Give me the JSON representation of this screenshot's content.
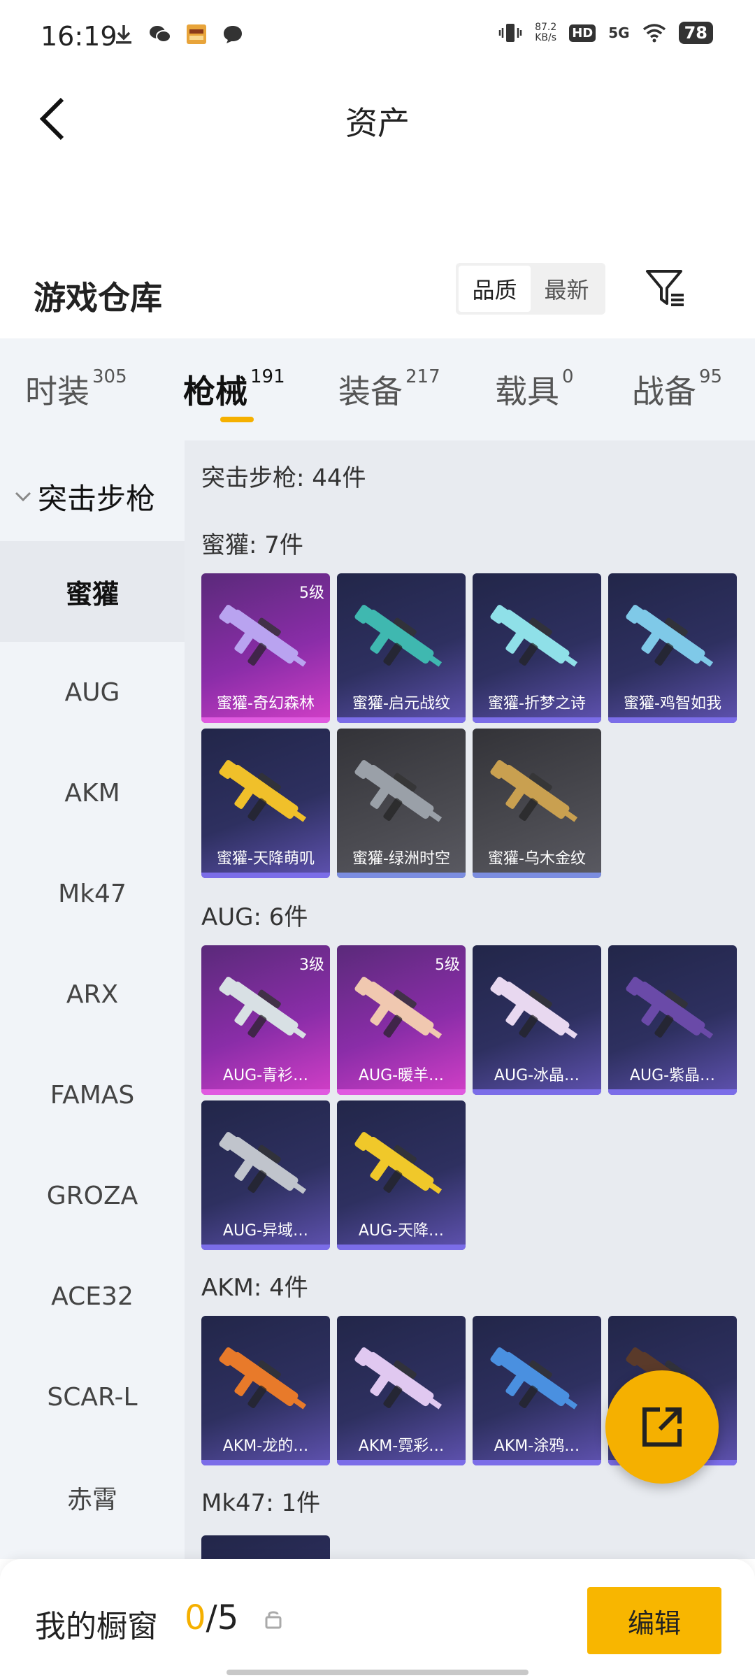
{
  "status_bar": {
    "time": "16:19",
    "speed_value": "87.2",
    "speed_unit": "KB/s",
    "hd": "HD",
    "network": "5G",
    "battery": "78"
  },
  "header": {
    "title": "资产"
  },
  "warehouse": {
    "title": "游戏仓库",
    "sort_options": [
      "品质",
      "最新"
    ],
    "active_sort": "品质"
  },
  "tabs": [
    {
      "label": "时装",
      "count": "305"
    },
    {
      "label": "枪械",
      "count": "191"
    },
    {
      "label": "装备",
      "count": "217"
    },
    {
      "label": "载具",
      "count": "0"
    },
    {
      "label": "战备",
      "count": "95"
    }
  ],
  "sidebar": {
    "category": "突击步枪",
    "items": [
      "蜜獾",
      "AUG",
      "AKM",
      "Mk47",
      "ARX",
      "FAMAS",
      "GROZA",
      "ACE32",
      "SCAR-L",
      "赤霄"
    ],
    "active_item": "蜜獾"
  },
  "content": {
    "category_summary": "突击步枪: 44件",
    "sections": [
      {
        "title": "蜜獾: 7件",
        "items": [
          {
            "name": "蜜獾-奇幻森林",
            "level": "5级",
            "rarity": "purple",
            "gun_color": "#b9a3f0"
          },
          {
            "name": "蜜獾-启元战纹",
            "level": "",
            "rarity": "blue",
            "gun_color": "#3fb8b0"
          },
          {
            "name": "蜜獾-折梦之诗",
            "level": "",
            "rarity": "blue",
            "gun_color": "#8fe0e8"
          },
          {
            "name": "蜜獾-鸡智如我",
            "level": "",
            "rarity": "blue",
            "gun_color": "#7fc9e8"
          },
          {
            "name": "蜜獾-天降萌叽",
            "level": "",
            "rarity": "blue",
            "gun_color": "#f0c02a"
          },
          {
            "name": "蜜獾-绿洲时空",
            "level": "",
            "rarity": "gray",
            "gun_color": "#9aa0a8"
          },
          {
            "name": "蜜獾-乌木金纹",
            "level": "",
            "rarity": "gray",
            "gun_color": "#c9a050"
          }
        ]
      },
      {
        "title": "AUG: 6件",
        "items": [
          {
            "name": "AUG-青衫…",
            "level": "3级",
            "rarity": "purple",
            "gun_color": "#d8e0e4"
          },
          {
            "name": "AUG-暖羊…",
            "level": "5级",
            "rarity": "purple",
            "gun_color": "#f0c8b0"
          },
          {
            "name": "AUG-冰晶…",
            "level": "",
            "rarity": "blue",
            "gun_color": "#e8d8f0"
          },
          {
            "name": "AUG-紫晶…",
            "level": "",
            "rarity": "blue",
            "gun_color": "#6a4aa8"
          },
          {
            "name": "AUG-异域…",
            "level": "",
            "rarity": "blue",
            "gun_color": "#c0c4cc"
          },
          {
            "name": "AUG-天降…",
            "level": "",
            "rarity": "blue",
            "gun_color": "#f0c82a"
          }
        ]
      },
      {
        "title": "AKM: 4件",
        "items": [
          {
            "name": "AKM-龙的…",
            "level": "",
            "rarity": "blue",
            "gun_color": "#e87a2a"
          },
          {
            "name": "AKM-霓彩…",
            "level": "",
            "rarity": "blue",
            "gun_color": "#e0c8f0"
          },
          {
            "name": "AKM-涂鸦…",
            "level": "",
            "rarity": "blue",
            "gun_color": "#4a90e0"
          },
          {
            "name": "",
            "level": "",
            "rarity": "blue",
            "gun_color": "#5a3a2a"
          }
        ]
      },
      {
        "title": "Mk47: 1件",
        "items": []
      }
    ]
  },
  "bottom": {
    "title": "我的橱窗",
    "current": "0",
    "total": "/5",
    "edit_label": "编辑"
  },
  "colors": {
    "accent": "#f5b000",
    "purple_card": "#8a2da8",
    "blue_card": "#2e3060",
    "gray_card": "#4a4a50"
  }
}
